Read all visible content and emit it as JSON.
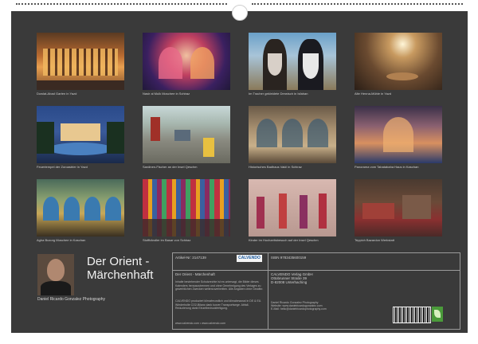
{
  "calendar": {
    "title_line1": "Der Orient -",
    "title_line2": "Märchenhaft",
    "author": "Daniel Ricardo Gonzalez Photography"
  },
  "photos": [
    {
      "caption": "Dowlat-Abad Garten in Yazd"
    },
    {
      "caption": "Nasir al Mulk Moschee in Schiraz"
    },
    {
      "caption": "Im Tracher gekleidete Derwisch in Isfahan"
    },
    {
      "caption": "Alte Henna-Mühle in Yazd"
    },
    {
      "caption": "Feuertempel der Zoroastrier in Yazd"
    },
    {
      "caption": "Sardinen-Fischer an der Insel Qeschm"
    },
    {
      "caption": "Historisches Badhaus Vakil in Schiraz"
    },
    {
      "caption": "Panorama vom Tabatabaha Haus in Kaschan"
    },
    {
      "caption": "Agha Bozorg Moschee in Kaschan"
    },
    {
      "caption": "Stoffhändler im Basar von Schiraz"
    },
    {
      "caption": "Kinder im Hochzeitsbesuch auf der Insel Qeschm"
    },
    {
      "caption": "Teppich Bazardon Werkstatt"
    }
  ],
  "info": {
    "article": "Artikel-Nr: 2147139",
    "isbn": "ISBN 9783435600159",
    "publisher_logo": "CALVENDO",
    "product_title": "Der Orient - Märchenhaft",
    "publisher_name": "CALVENDO Verlag GmbH",
    "publisher_street": "Ottobrunner Straße 39",
    "publisher_city": "D-82008 Unterhaching",
    "description": "Inhalte bestehender Schutzrechte ist es untersagt, die Bilder dieses Kalenders herauszutrennen und ohne Genehmigung des Verlages zu gewerblichen Zwecken weiterzuverbreiten. Alle Angaben ohne Gewähr.",
    "eco_text": "CALVENDO produziert klimafreundlich und klimabewusst in DE & EU. Wiederholte CO2-Bilanz dank kurzer Transportwege. Abfall-Reduzierung dank Einzelbedruckfertigung.",
    "footer_url": "www.calvendo.com • www.calvendo.com",
    "contact": "Daniel Ricardo Gonzalez Photography",
    "contact_web": "Website: www.danielricardogonzalez.com",
    "contact_mail": "E-Mail: hello@danielricardophotography.com"
  },
  "colors": {
    "sheet": "#3a3a3a",
    "accent_green": "#4a9a3a"
  }
}
